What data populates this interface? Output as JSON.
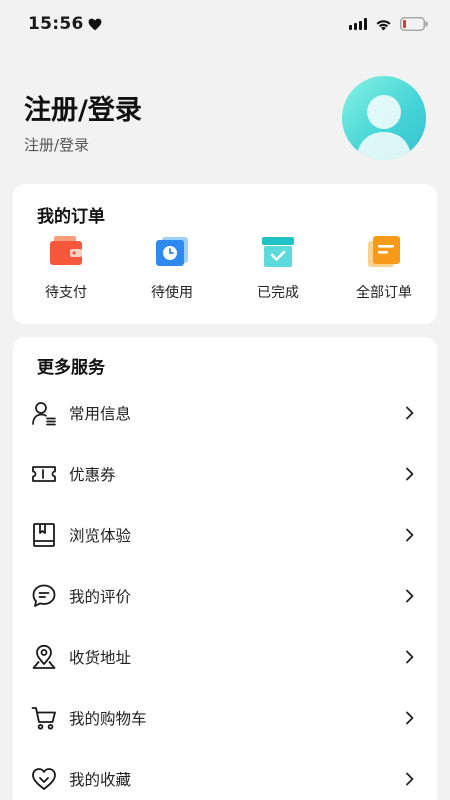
{
  "status_bar": {
    "time": "15:56"
  },
  "profile": {
    "title": "注册/登录",
    "subtitle": "注册/登录"
  },
  "orders": {
    "title": "我的订单",
    "items": [
      {
        "label": "待支付",
        "icon": "wallet-icon",
        "color": "#f4573a"
      },
      {
        "label": "待使用",
        "icon": "clock-icon",
        "color": "#2f8af0"
      },
      {
        "label": "已完成",
        "icon": "check-box-icon",
        "color": "#20c2c6"
      },
      {
        "label": "全部订单",
        "icon": "document-icon",
        "color": "#f79a1a"
      }
    ]
  },
  "services": {
    "title": "更多服务",
    "items": [
      {
        "label": "常用信息",
        "icon": "user-info-icon"
      },
      {
        "label": "优惠券",
        "icon": "ticket-icon"
      },
      {
        "label": "浏览体验",
        "icon": "book-icon"
      },
      {
        "label": "我的评价",
        "icon": "chat-bubble-icon"
      },
      {
        "label": "收货地址",
        "icon": "location-icon"
      },
      {
        "label": "我的购物车",
        "icon": "cart-icon"
      },
      {
        "label": "我的收藏",
        "icon": "heart-icon"
      }
    ]
  }
}
